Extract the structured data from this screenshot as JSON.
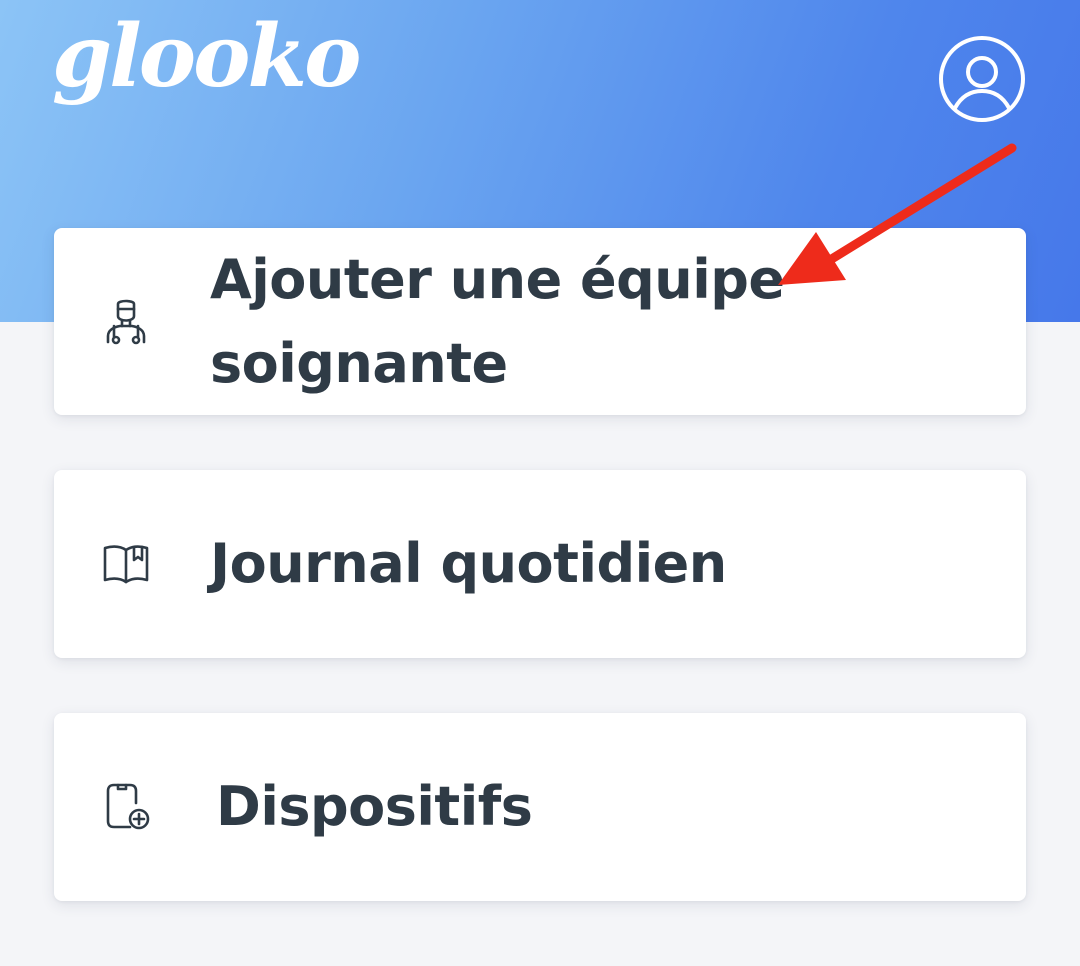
{
  "header": {
    "logo_text": "glooko",
    "account_icon": "user-circle-icon",
    "gradient_colors": [
      "#8cc4f6",
      "#4678ea"
    ]
  },
  "menu": {
    "items": [
      {
        "label": "Ajouter une équipe soignante",
        "icon": "doctor-icon"
      },
      {
        "label": "Journal quotidien",
        "icon": "book-icon"
      },
      {
        "label": "Dispositifs",
        "icon": "device-plus-icon"
      }
    ]
  },
  "annotation": {
    "arrow_color": "#ee2b1b"
  },
  "colors": {
    "text": "#2f3b46",
    "card_bg": "#ffffff",
    "page_bg": "#f4f5f8"
  }
}
